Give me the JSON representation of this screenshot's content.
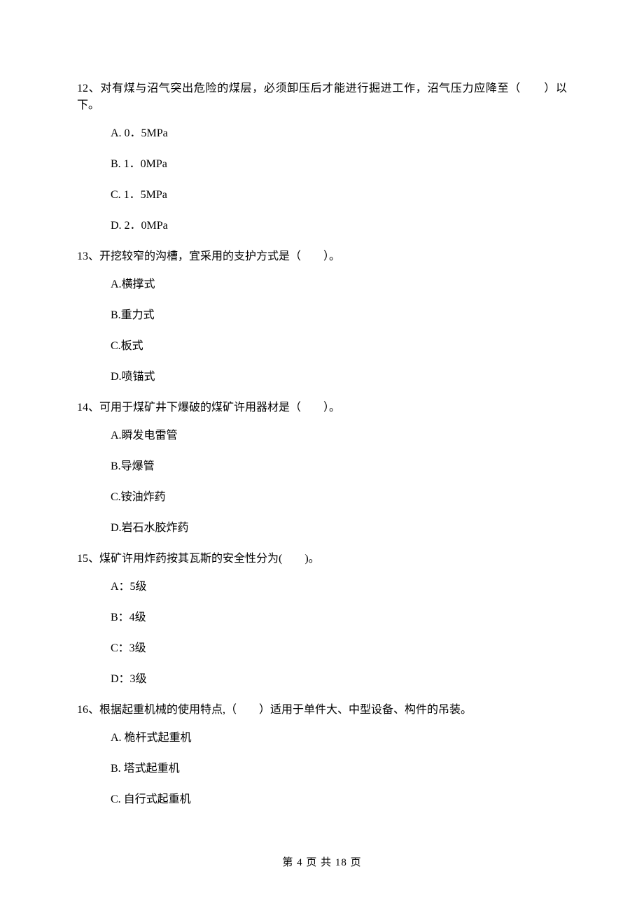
{
  "questions": [
    {
      "number": "12",
      "text": "12、对有煤与沼气突出危险的煤层，必须卸压后才能进行掘进工作，沼气压力应降至（　　）以下。",
      "options": {
        "a": "A. 0．5MPa",
        "b": "B. 1．0MPa",
        "c": "C. 1．5MPa",
        "d": "D. 2．0MPa"
      }
    },
    {
      "number": "13",
      "text": "13、开挖较窄的沟槽，宜采用的支护方式是（　　）。",
      "options": {
        "a": "A.横撑式",
        "b": "B.重力式",
        "c": "C.板式",
        "d": "D.喷锚式"
      }
    },
    {
      "number": "14",
      "text": "14、可用于煤矿井下爆破的煤矿许用器材是（　　）。",
      "options": {
        "a": "A.瞬发电雷管",
        "b": "B.导爆管",
        "c": "C.铵油炸药",
        "d": "D.岩石水胶炸药"
      }
    },
    {
      "number": "15",
      "text": "15、煤矿许用炸药按其瓦斯的安全性分为(　　)。",
      "options": {
        "a": "A：5级",
        "b": "B：4级",
        "c": "C：3级",
        "d": "D：3级"
      }
    },
    {
      "number": "16",
      "text": "16、根据起重机械的使用特点,（　　）适用于单件大、中型设备、构件的吊装。",
      "options": {
        "a": "A. 桅杆式起重机",
        "b": "B. 塔式起重机",
        "c": "C. 自行式起重机"
      }
    }
  ],
  "footer": "第 4 页 共 18 页"
}
